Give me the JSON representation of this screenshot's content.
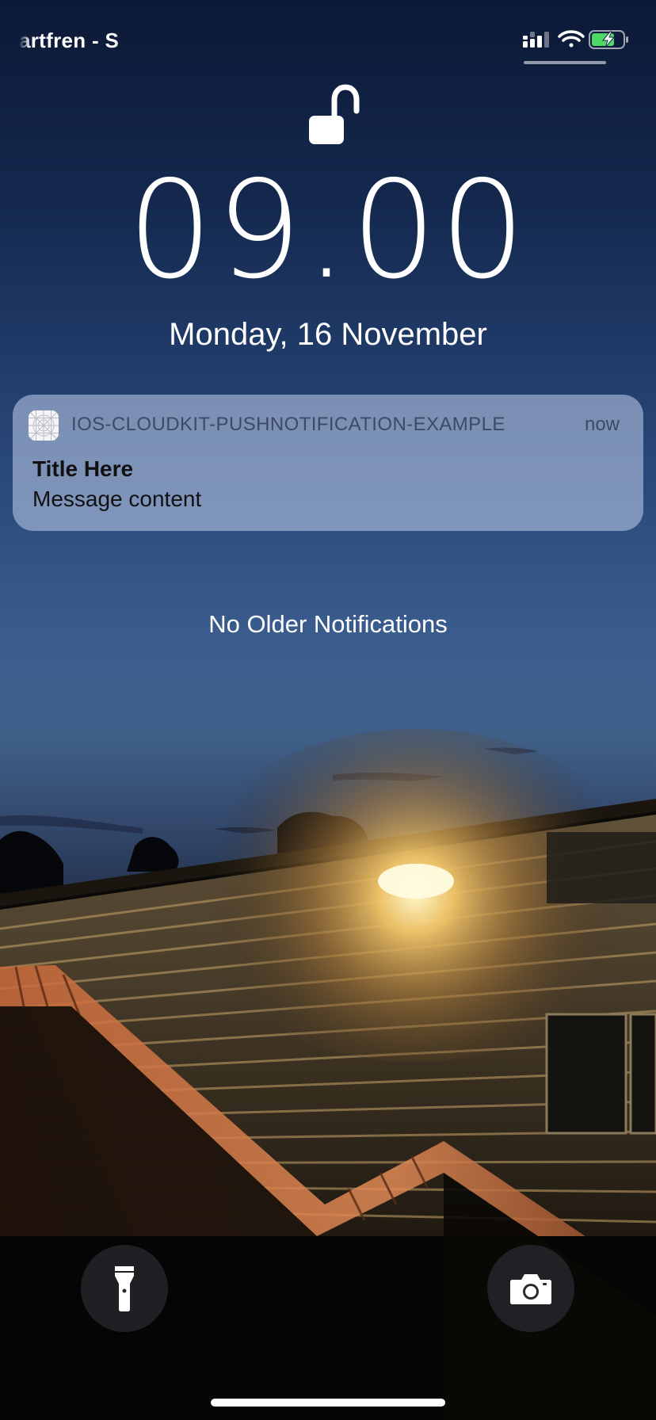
{
  "status_bar": {
    "carrier": "artfren - S",
    "icons": [
      "cellular-signal-icon",
      "wifi-icon",
      "battery-charging-icon"
    ]
  },
  "lock_screen": {
    "lock_state_icon": "unlocked-padlock-icon",
    "time": "09.00",
    "date": "Monday, 16 November"
  },
  "notification": {
    "app_name": "IOS-CLOUDKIT-PUSHNOTIFICATION-EXAMPLE",
    "time": "now",
    "title": "Title Here",
    "message": "Message content",
    "app_icon": "app-placeholder-icon"
  },
  "no_older_notifications": "No Older Notifications",
  "quick_actions": {
    "left_icon": "flashlight-icon",
    "right_icon": "camera-icon"
  },
  "colors": {
    "accent_battery": "#4cd964",
    "notification_text_secondary": "#3d4a66"
  }
}
